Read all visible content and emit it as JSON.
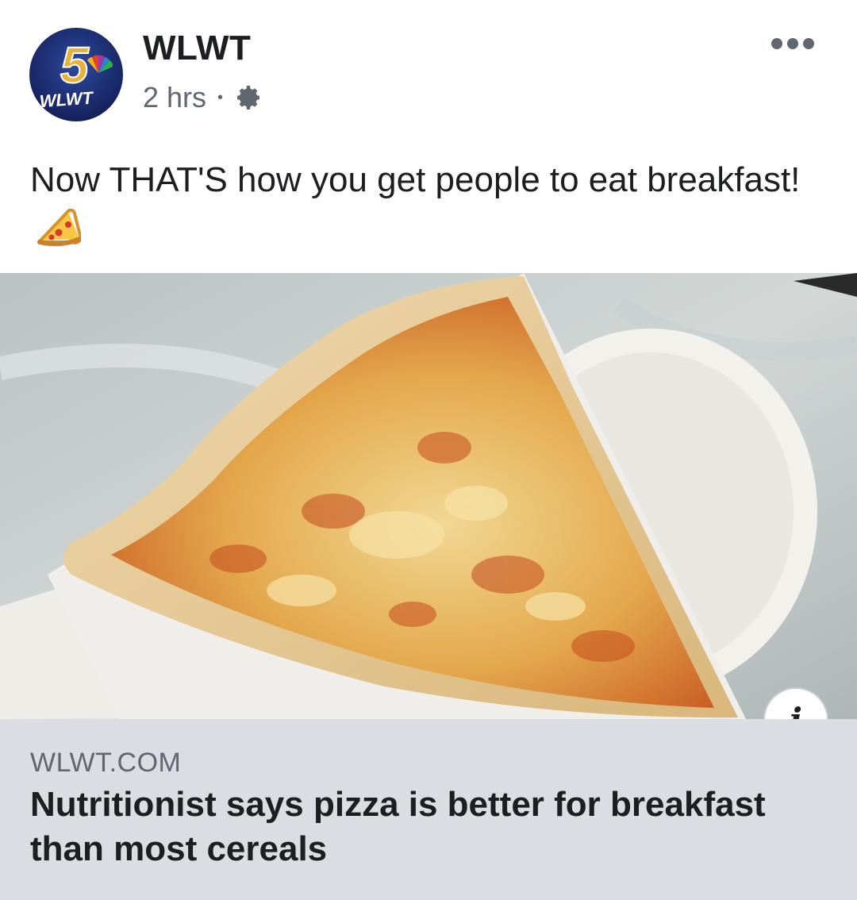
{
  "post": {
    "page_name": "WLWT",
    "timestamp": "2 hrs",
    "separator": "•",
    "privacy_icon": "gear-icon",
    "avatar": {
      "channel_number": "5",
      "station": "WLWT",
      "icon": "nbc-peacock-logo"
    },
    "more_icon": "more-options-icon",
    "caption": "Now THAT'S how you get people to eat breakfast!",
    "caption_emoji": "pizza-emoji"
  },
  "link_preview": {
    "image_subject": "pizza-slice-photo",
    "info_icon": "info-icon",
    "info_glyph": "i",
    "domain": "WLWT.COM",
    "headline": "Nutritionist says pizza is better for breakfast than most cereals"
  },
  "colors": {
    "background": "#ffffff",
    "text_primary": "#1c1e21",
    "text_secondary": "#606770",
    "link_box_bg": "#dadde1",
    "logo_blue": "#1b2a6b",
    "logo_gold": "#e8b13a"
  }
}
